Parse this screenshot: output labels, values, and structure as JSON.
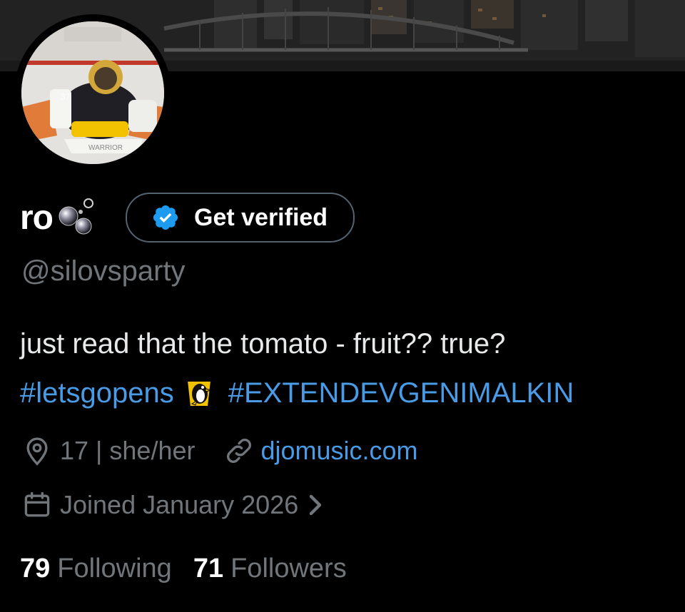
{
  "profile": {
    "display_name": "ro",
    "handle": "@silovsparty",
    "verify_label": "Get verified",
    "bio_line1": "just read that the tomato - fruit?? true?",
    "hashtag1": "#letsgopens",
    "hashtag2": "#EXTENDEVGENIMALKIN",
    "location": "17 | she/her",
    "website": "djomusic.com",
    "joined": "Joined January 2026",
    "following_count": "79",
    "following_label": "Following",
    "followers_count": "71",
    "followers_label": "Followers"
  },
  "icons": {
    "location": "location-pin-icon",
    "link": "link-icon",
    "calendar": "calendar-icon",
    "verified": "verified-badge-icon",
    "chevron": "chevron-right-icon"
  },
  "colors": {
    "background": "#000000",
    "accent": "#1d9bf0",
    "muted_text": "#71767b",
    "primary_text": "#e7e9ea"
  }
}
